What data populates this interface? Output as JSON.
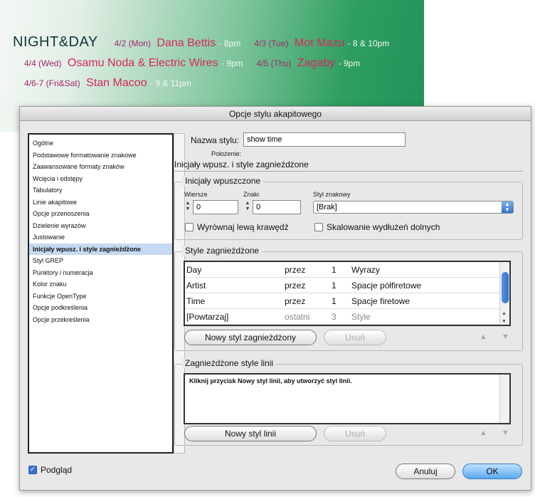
{
  "banner": {
    "title": "NIGHT&DAY",
    "events": [
      {
        "date": "4/2 (Mon)",
        "artist": "Dana Bettis",
        "time": "- 8pm"
      },
      {
        "date": "4/3 (Tue)",
        "artist": "Mot Mazu",
        "time": "- 8 & 10pm"
      },
      {
        "date": "4/4 (Wed)",
        "artist": "Osamu Noda & Electric Wires",
        "time": "- 9pm"
      },
      {
        "date": "4/5 (Thu)",
        "artist": "Zagaby",
        "time": "- 9pm"
      },
      {
        "date": "4/6-7 (Fri&Sat)",
        "artist": "Stan Macoo",
        "time": "- 9 & 11pm"
      }
    ]
  },
  "dialog": {
    "title": "Opcje stylu akapitowego",
    "sidebar": [
      "Ogólne",
      "Podstawowe formatowanie znakowe",
      "Zaawansowane formaty znaków",
      "Wcięcia i odstępy",
      "Tabulatory",
      "Linie akapitowe",
      "Opcje przenoszenia",
      "Dzielenie wyrazów",
      "Justowanie",
      "Inicjały wpusz. i style zagnieżdżone",
      "Styl GREP",
      "Punktory i numeracja",
      "Kolor znaku",
      "Funkcje OpenType",
      "Opcje podkreślenia",
      "Opcje przekreślenia"
    ],
    "style_name_label": "Nazwa stylu:",
    "style_name_value": "show time",
    "position_label": "Położenie:",
    "section_title": "Inicjały wpusz. i style zagnieżdżone",
    "dropcaps": {
      "title": "Inicjały wpuszczone",
      "lines_label": "Wiersze",
      "lines_value": "0",
      "chars_label": "Znaki",
      "chars_value": "0",
      "charstyle_label": "Styl znakowy",
      "charstyle_value": "[Brak]",
      "align_left_label": "Wyrównaj lewą krawędź",
      "scale_label": "Skalowanie wydłużeń dolnych"
    },
    "nested": {
      "title": "Style zagnieżdżone",
      "rows": [
        {
          "style": "Day",
          "rel": "przez",
          "num": "1",
          "what": "Wyrazy"
        },
        {
          "style": "Artist",
          "rel": "przez",
          "num": "1",
          "what": "Spacje półfiretowe"
        },
        {
          "style": "Time",
          "rel": "przez",
          "num": "1",
          "what": "Spacje firetowe"
        },
        {
          "style": "[Powtarzaj]",
          "rel": "ostatni",
          "num": "3",
          "what": "Style"
        }
      ],
      "new_button": "Nowy styl zagnieżdżony",
      "delete_button": "Usuń"
    },
    "nested_lines": {
      "title": "Zagnieżdżone style linii",
      "hint": "Kliknij przycisk Nowy styl linii, aby utworzyć styl linii.",
      "new_button": "Nowy styl linii",
      "delete_button": "Usuń"
    },
    "preview_label": "Podgląd",
    "cancel_button": "Anuluj",
    "ok_button": "OK"
  }
}
